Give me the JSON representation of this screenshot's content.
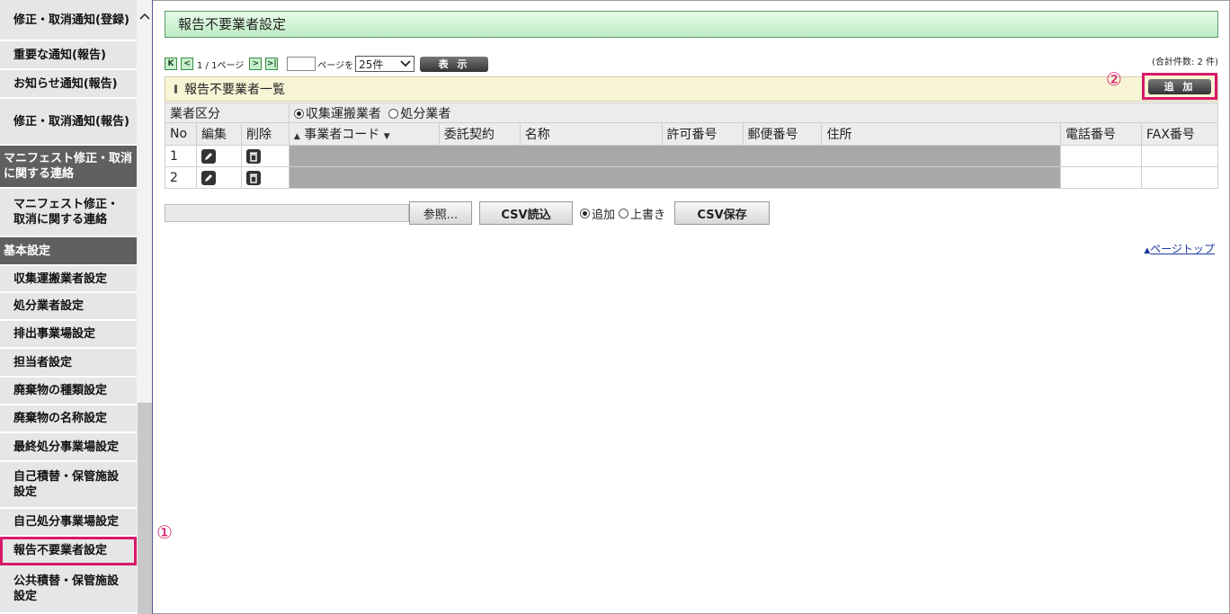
{
  "sidebar": {
    "items": [
      {
        "label": "修正・取消通知(登録)",
        "type": "item"
      },
      {
        "label": "重要な通知(報告)",
        "type": "item"
      },
      {
        "label": "お知らせ通知(報告)",
        "type": "item"
      },
      {
        "label": "修正・取消通知(報告)",
        "type": "item"
      },
      {
        "label": "マニフェスト修正・取消に関する連絡",
        "type": "header"
      },
      {
        "label": "マニフェスト修正・取消に関する連絡",
        "type": "item"
      },
      {
        "label": "基本設定",
        "type": "header"
      },
      {
        "label": "収集運搬業者設定",
        "type": "item"
      },
      {
        "label": "処分業者設定",
        "type": "item"
      },
      {
        "label": "排出事業場設定",
        "type": "item"
      },
      {
        "label": "担当者設定",
        "type": "item"
      },
      {
        "label": "廃棄物の種類設定",
        "type": "item"
      },
      {
        "label": "廃棄物の名称設定",
        "type": "item"
      },
      {
        "label": "最終処分事業場設定",
        "type": "item"
      },
      {
        "label": "自己積替・保管施設設定",
        "type": "item"
      },
      {
        "label": "自己処分事業場設定",
        "type": "item"
      },
      {
        "label": "報告不要業者設定",
        "type": "item",
        "selected": true
      },
      {
        "label": "公共積替・保管施設設定",
        "type": "item"
      }
    ],
    "scroll_up_icon": "chevron-up-icon"
  },
  "annotations": {
    "one": "①",
    "two": "②"
  },
  "title": "報告不要業者設定",
  "pager": {
    "first": "K",
    "prev": "<",
    "page_text": "1 / 1ページ",
    "next": ">",
    "last": ">|",
    "page_input_value": "",
    "per_label": "ページを",
    "per_value": "25件",
    "show_label": "表 示"
  },
  "total_text": "(合計件数: 2 件)",
  "list_title": "報告不要業者一覧",
  "add_label": "追 加",
  "kubun": {
    "label": "業者区分",
    "options": [
      {
        "label": "収集運搬業者",
        "checked": true
      },
      {
        "label": "処分業者",
        "checked": false
      }
    ]
  },
  "columns": [
    "No",
    "編集",
    "削除",
    "事業者コード",
    "委託契約",
    "名称",
    "許可番号",
    "郵便番号",
    "住所",
    "電話番号",
    "FAX番号"
  ],
  "rows": [
    {
      "no": "1"
    },
    {
      "no": "2"
    }
  ],
  "csv": {
    "browse_label": "参照...",
    "read_label": "CSV読込",
    "mode_options": [
      {
        "label": "追加",
        "checked": true
      },
      {
        "label": "上書き",
        "checked": false
      }
    ],
    "save_label": "CSV保存"
  },
  "page_top": {
    "arrow": "▲",
    "label": "ページトップ"
  },
  "colors": {
    "accent": "#d8196b",
    "title_green": "#bfecc4",
    "sidebar_header": "#606060",
    "list_head": "#f8f5d6"
  }
}
